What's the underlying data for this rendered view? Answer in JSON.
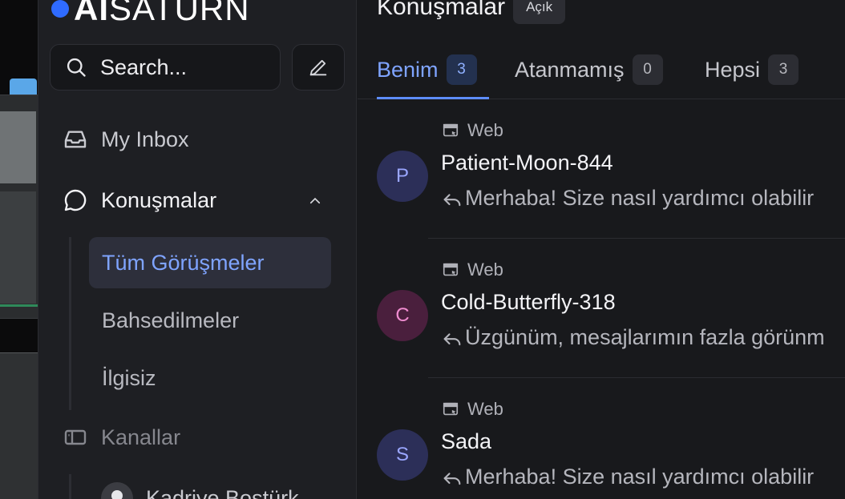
{
  "brand": {
    "logo_text_bold": "AI",
    "logo_text": "SATURN",
    "accent": "#2f6bff"
  },
  "sidebar": {
    "search_placeholder": "Search...",
    "nav": {
      "inbox": "My Inbox",
      "conversations": "Konuşmalar",
      "channels": "Kanallar"
    },
    "sub_items": [
      {
        "label": "Tüm Görüşmeler",
        "active": true
      },
      {
        "label": "Bahsedilmeler",
        "active": false
      },
      {
        "label": "İlgisiz",
        "active": false
      }
    ],
    "agent_name": "Kadriye Bostürk"
  },
  "main": {
    "title": "Konuşmalar",
    "status_badge": "Açık",
    "tabs": [
      {
        "label": "Benim",
        "count": "3",
        "active": true
      },
      {
        "label": "Atanmamış",
        "count": "0",
        "active": false
      },
      {
        "label": "Hepsi",
        "count": "3",
        "active": false
      }
    ],
    "conversations": [
      {
        "initial": "P",
        "channel": "Web",
        "name": "Patient-Moon-844",
        "message": "Merhaba! Size nasıl yardımcı olabilir"
      },
      {
        "initial": "C",
        "channel": "Web",
        "name": "Cold-Butterfly-318",
        "message": "Üzgünüm, mesajlarımın fazla görünm"
      },
      {
        "initial": "S",
        "channel": "Web",
        "name": "Sada",
        "message": "Merhaba! Size nasıl yardımcı olabilir"
      }
    ]
  }
}
